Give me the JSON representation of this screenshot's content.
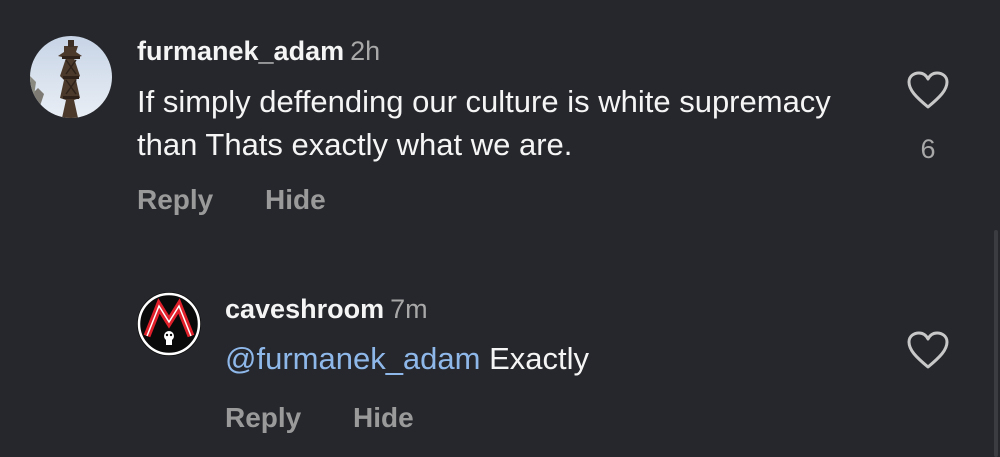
{
  "comments": [
    {
      "username": "furmanek_adam",
      "time": "2h",
      "text": "If simply deffending our culture is white supremacy than Thats exactly what we are.",
      "likes": "6",
      "reply_label": "Reply",
      "hide_label": "Hide",
      "avatar_icon": "tower-photo-avatar"
    },
    {
      "username": "caveshroom",
      "time": "7m",
      "mention": "@furmanek_adam",
      "text": "Exactly",
      "reply_label": "Reply",
      "hide_label": "Hide",
      "avatar_icon": "red-logo-avatar"
    }
  ],
  "colors": {
    "background": "#25272c",
    "text": "#f5f5f5",
    "muted": "#a8a8a8",
    "mention": "#8fb8ea"
  }
}
